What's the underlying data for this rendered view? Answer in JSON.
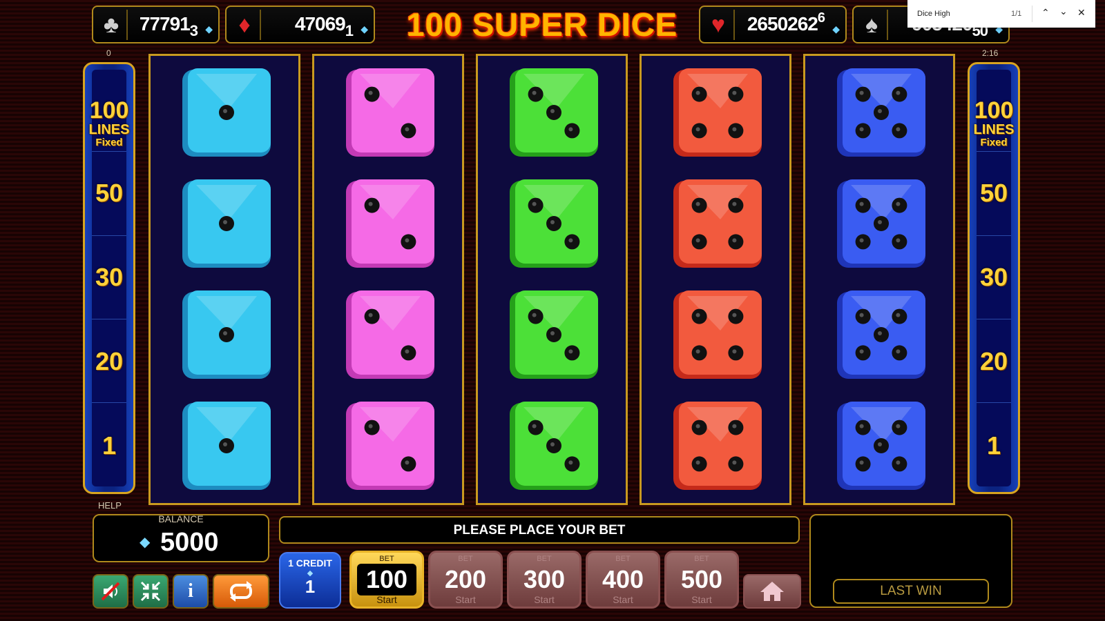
{
  "game": {
    "title": "100 SUPER DICE"
  },
  "jackpots": [
    {
      "suit": "club-icon",
      "glyph": "♣",
      "color": "#d0d0d0",
      "main": "77791",
      "sub": "3",
      "sup": ""
    },
    {
      "suit": "diamond-icon",
      "glyph": "♦",
      "color": "#e0262a",
      "main": "47069",
      "sub": "1",
      "sup": ""
    },
    {
      "suit": "heart-icon",
      "glyph": "♥",
      "color": "#e0262a",
      "main": "2650262",
      "sub": "",
      "sup": "6"
    },
    {
      "suit": "spade-icon",
      "glyph": "♠",
      "color": "#d0d0d0",
      "main": "905420",
      "sub": "50",
      "sup": ""
    }
  ],
  "labels": {
    "left_small": "0",
    "right_small": "2:16",
    "help": "HELP",
    "balance_label": "BALANCE",
    "balance_value": "5000",
    "message": "PLEASE PLACE YOUR BET",
    "last_win": "LAST WIN"
  },
  "lines_panel": {
    "count": "100",
    "word": "LINES",
    "fixed": "Fixed",
    "markers": [
      "50",
      "30",
      "20",
      "1"
    ]
  },
  "reels": [
    {
      "color": "#38c8f0",
      "shade": "#1d8cc0",
      "face": 1
    },
    {
      "color": "#f56ae6",
      "shade": "#c33ab5",
      "face": 2
    },
    {
      "color": "#4ce038",
      "shade": "#25a01a",
      "face": 3
    },
    {
      "color": "#f25a3e",
      "shade": "#c52a1a",
      "face": 4
    },
    {
      "color": "#3a5cf2",
      "shade": "#1f35b8",
      "face": 5
    }
  ],
  "credit": {
    "label": "1 CREDIT",
    "value": "1"
  },
  "bets": [
    {
      "label": "BET",
      "value": "100",
      "start": "Start",
      "selected": true
    },
    {
      "label": "BET",
      "value": "200",
      "start": "Start",
      "selected": false
    },
    {
      "label": "BET",
      "value": "300",
      "start": "Start",
      "selected": false
    },
    {
      "label": "BET",
      "value": "400",
      "start": "Start",
      "selected": false
    },
    {
      "label": "BET",
      "value": "500",
      "start": "Start",
      "selected": false
    }
  ],
  "controls": [
    {
      "name": "sound-off-button",
      "icon": "sound-off-icon"
    },
    {
      "name": "fullscreen-exit-button",
      "icon": "compress-icon"
    },
    {
      "name": "info-button",
      "icon": "info-icon"
    },
    {
      "name": "autoplay-button",
      "icon": "repeat-icon"
    },
    {
      "name": "home-button",
      "icon": "home-icon"
    }
  ],
  "findbar": {
    "query": "Dice High",
    "count": "1/1"
  }
}
